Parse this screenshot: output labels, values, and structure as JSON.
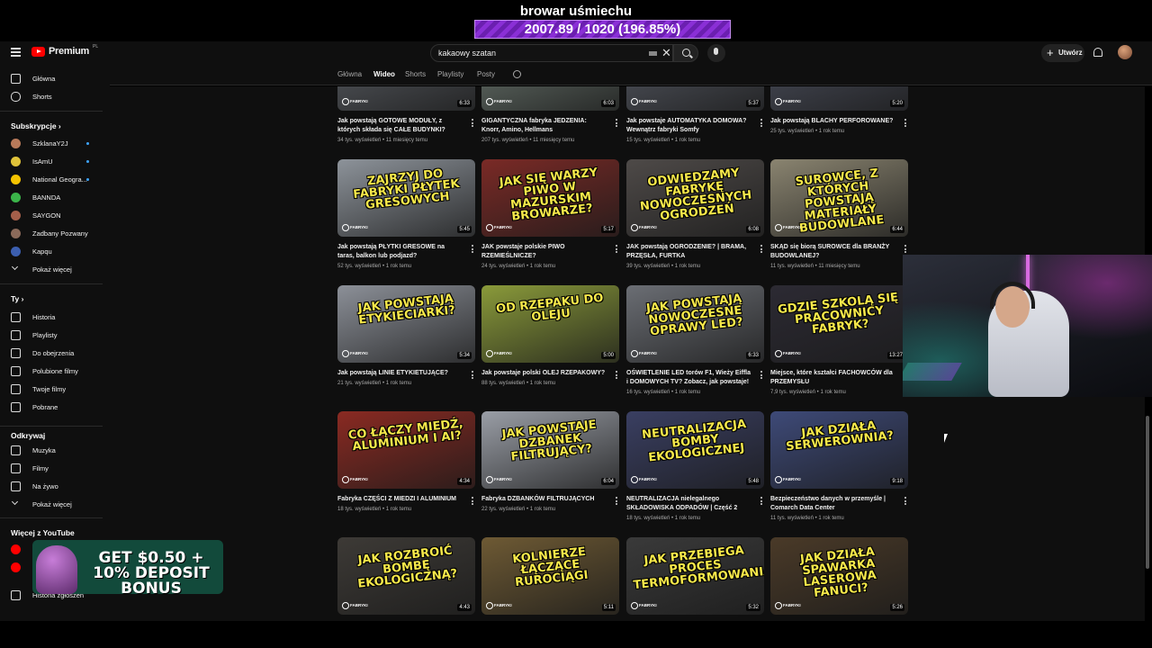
{
  "stream": {
    "title": "browar uśmiechu",
    "progress_text": "2007.89 / 1020 (196.85%)",
    "progress_percent": 196.85
  },
  "topbar": {
    "brand": "Premium",
    "brand_suffix": "PL",
    "search_value": "kakaowy szatan",
    "create_label": "Utwórz"
  },
  "sidebar": {
    "main": [
      {
        "label": "Główna",
        "icon": "home-icon"
      },
      {
        "label": "Shorts",
        "icon": "shorts-icon"
      }
    ],
    "subs_heading": "Subskrypcje",
    "subs": [
      {
        "label": "SzklanaY2J",
        "dot": true,
        "color": "#b87a5a"
      },
      {
        "label": "IsAmU",
        "dot": true,
        "color": "#e0c33a"
      },
      {
        "label": "National Geogra...",
        "dot": true,
        "color": "#f5c400"
      },
      {
        "label": "BANNDA",
        "dot": false,
        "color": "#3bb54a"
      },
      {
        "label": "SAYGON",
        "dot": false,
        "color": "#a55f4a"
      },
      {
        "label": "Zadbany Pozwany",
        "dot": false,
        "color": "#8b6a5a"
      },
      {
        "label": "Kapqu",
        "dot": false,
        "color": "#3c5fb0"
      }
    ],
    "subs_more": "Pokaż więcej",
    "you_heading": "Ty",
    "you": [
      {
        "label": "Historia",
        "icon": "history-icon"
      },
      {
        "label": "Playlisty",
        "icon": "playlist-icon"
      },
      {
        "label": "Do obejrzenia",
        "icon": "watch-later-icon"
      },
      {
        "label": "Polubione filmy",
        "icon": "like-icon"
      },
      {
        "label": "Twoje filmy",
        "icon": "your-videos-icon"
      },
      {
        "label": "Pobrane",
        "icon": "download-icon"
      }
    ],
    "explore_heading": "Odkrywaj",
    "explore": [
      {
        "label": "Muzyka",
        "icon": "music-icon"
      },
      {
        "label": "Filmy",
        "icon": "movies-icon"
      },
      {
        "label": "Na żywo",
        "icon": "live-icon"
      }
    ],
    "explore_more": "Pokaż więcej",
    "more_heading": "Więcej z YouTube",
    "report_history": "Historia zgłoszeń"
  },
  "tabs": [
    "Główna",
    "Wideo",
    "Shorts",
    "Playlisty",
    "Posty"
  ],
  "active_tab": "Wideo",
  "videos": [
    {
      "title": "Jak powstają GOTOWE MODUŁY, z których składa się CAŁE BUDYNKI?",
      "meta": "34 tys. wyświetleń • 11 miesięcy temu",
      "duration": "6:33",
      "thumb_text": "",
      "bg": "#5c6066"
    },
    {
      "title": "GIGANTYCZNA fabryka JEDZENIA: Knorr, Amino, Hellmans",
      "meta": "207 tys. wyświetleń • 11 miesięcy temu",
      "duration": "6:03",
      "thumb_text": "",
      "bg": "#6e7a72"
    },
    {
      "title": "Jak powstaje AUTOMATYKA DOMOWA? Wewnątrz fabryki Somfy",
      "meta": "15 tys. wyświetleń • 1 rok temu",
      "duration": "5:37",
      "thumb_text": "",
      "bg": "#585c66"
    },
    {
      "title": "Jak powstają BLACHY PERFOROWANE?",
      "meta": "25 tys. wyświetleń • 1 rok temu",
      "duration": "5:20",
      "thumb_text": "",
      "bg": "#4e5260"
    },
    {
      "title": "Jak powstają PŁYTKI GRESOWE na taras, balkon lub podjazd?",
      "meta": "52 tys. wyświetleń • 1 rok temu",
      "duration": "5:45",
      "thumb_text": "ZAJRZYJ DO FABRYKI PŁYTEK GRESOWYCH",
      "bg": "#8d939a"
    },
    {
      "title": "JAK powstaje polskie PIWO RZEMIEŚLNICZE?",
      "meta": "24 tys. wyświetleń • 1 rok temu",
      "duration": "5:17",
      "thumb_text": "JAK SIĘ WARZY PIWO W MAZURSKIM BROWARZE?",
      "bg": "#7a2a26"
    },
    {
      "title": "JAK powstają OGRODZENIE? | BRAMA, PRZĘSŁA, FURTKA",
      "meta": "39 tys. wyświetleń • 1 rok temu",
      "duration": "6:08",
      "thumb_text": "ODWIEDZAMY FABRYKĘ NOWOCZESNYCH OGRODZEŃ",
      "bg": "#4e4a48"
    },
    {
      "title": "SKĄD się biorą SUROWCE dla BRANŻY BUDOWLANEJ?",
      "meta": "11 tys. wyświetleń • 11 miesięcy temu",
      "duration": "6:44",
      "thumb_text": "SUROWCE, Z KTÓRYCH POWSTAJĄ MATERIAŁY BUDOWLANE",
      "bg": "#8a8470"
    },
    {
      "title": "Jak powstają LINIE ETYKIETUJĄCE?",
      "meta": "21 tys. wyświetleń • 1 rok temu",
      "duration": "5:34",
      "thumb_text": "JAK POWSTAJĄ ETYKIECIARKI?",
      "bg": "#8c9098"
    },
    {
      "title": "Jak powstaje polski OLEJ RZEPAKOWY?",
      "meta": "88 tys. wyświetleń • 1 rok temu",
      "duration": "5:00",
      "thumb_text": "OD RZEPAKU DO OLEJU",
      "bg": "#8a9a3a"
    },
    {
      "title": "OŚWIETLENIE LED torów F1, Wieży Eiffla i DOMOWYCH TV? Zobacz, jak powstaje!",
      "meta": "16 tys. wyświetleń • 1 rok temu",
      "duration": "6:33",
      "thumb_text": "JAK POWSTAJĄ NOWOCZESNE OPRAWY LED?",
      "bg": "#6b6e74"
    },
    {
      "title": "Miejsce, które kształci FACHOWCÓW dla PRZEMYSŁU",
      "meta": "7,9 tys. wyświetleń • 1 rok temu",
      "duration": "13:27",
      "thumb_text": "GDZIE SZKOLĄ SIĘ PRACOWNICY FABRYK?",
      "bg": "#2c2a33"
    },
    {
      "title": "Fabryka CZĘŚCI Z MIEDZI I ALUMINIUM",
      "meta": "18 tys. wyświetleń • 1 rok temu",
      "duration": "4:34",
      "thumb_text": "CO ŁĄCZY MIEDŹ, ALUMINIUM I AI?",
      "bg": "#8a2a22"
    },
    {
      "title": "Fabryka DZBANKÓW FILTRUJĄCYCH",
      "meta": "22 tys. wyświetleń • 1 rok temu",
      "duration": "6:04",
      "thumb_text": "JAK POWSTAJE DZBANEK FILTRUJĄCY?",
      "bg": "#9a9ea6"
    },
    {
      "title": "NEUTRALIZACJA nielegalnego SKŁADOWISKA ODPADÓW | Część 2",
      "meta": "18 tys. wyświetleń • 1 rok temu",
      "duration": "5:48",
      "thumb_text": "NEUTRALIZACJA BOMBY EKOLOGICZNEJ",
      "bg": "#3a3f62"
    },
    {
      "title": "Bezpieczeństwo danych w przemyśle | Comarch Data Center",
      "meta": "11 tys. wyświetleń • 1 rok temu",
      "duration": "9:18",
      "thumb_text": "JAK DZIAŁA SERWEROWNIA?",
      "bg": "#3e4a78"
    },
    {
      "title": "",
      "meta": "",
      "duration": "4:43",
      "thumb_text": "JAK ROZBROIĆ BOMBĘ EKOLOGICZNĄ?",
      "bg": "#3d3a36"
    },
    {
      "title": "",
      "meta": "",
      "duration": "5:11",
      "thumb_text": "KOLNIERZE ŁĄCZĄCE RUROCIĄGI",
      "bg": "#6e5a34"
    },
    {
      "title": "",
      "meta": "",
      "duration": "5:32",
      "thumb_text": "JAK PRZEBIEGA PROCES TERMOFORMOWANIA?",
      "bg": "#3a3a3a"
    },
    {
      "title": "",
      "meta": "",
      "duration": "5:26",
      "thumb_text": "JAK DZIAŁA SPAWARKA LASEROWA FANUCI?",
      "bg": "#4a3a28"
    }
  ],
  "thumb_brand": "FABRYKI",
  "ad": {
    "text": "GET $0.50 + 10% DEPOSIT BONUS"
  }
}
